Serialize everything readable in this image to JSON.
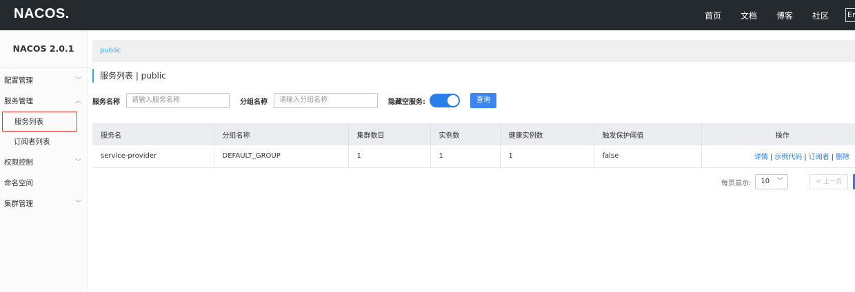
{
  "header": {
    "logo": "NACOS.",
    "nav": [
      "首页",
      "文档",
      "博客",
      "社区"
    ],
    "lang": "En"
  },
  "sidebar": {
    "version": "NACOS 2.0.1",
    "items": [
      {
        "label": "配置管理",
        "chevron": "﹀"
      },
      {
        "label": "服务管理",
        "chevron": "︿"
      },
      {
        "label": "服务列表"
      },
      {
        "label": "订阅者列表"
      },
      {
        "label": "权限控制",
        "chevron": "﹀"
      },
      {
        "label": "命名空间"
      },
      {
        "label": "集群管理",
        "chevron": "﹀"
      }
    ]
  },
  "breadcrumb": "public",
  "page": {
    "title": "服务列表 | public"
  },
  "filters": {
    "service_label": "服务名称",
    "service_placeholder": "请输入服务名称",
    "group_label": "分组名称",
    "group_placeholder": "请输入分组名称",
    "hide_empty_label": "隐藏空服务:",
    "hide_empty_on": true,
    "query_button": "查询"
  },
  "table": {
    "columns": [
      "服务名",
      "分组名称",
      "集群数目",
      "实例数",
      "健康实例数",
      "触发保护阈值",
      "操作"
    ],
    "rows": [
      {
        "service": "service-provider",
        "group": "DEFAULT_GROUP",
        "clusters": "1",
        "instances": "1",
        "healthy": "1",
        "threshold": "false",
        "actions": [
          "详情",
          "示例代码",
          "订阅者",
          "删除"
        ],
        "sep": "|"
      }
    ]
  },
  "pager": {
    "label": "每页显示:",
    "page_size": "10",
    "prev": "< 上一页"
  },
  "colors": {
    "accent": "#2b7de9",
    "breadcrumb": "#2eaadc",
    "topbar": "#252a2f",
    "highlight_border": "#e0342c"
  }
}
